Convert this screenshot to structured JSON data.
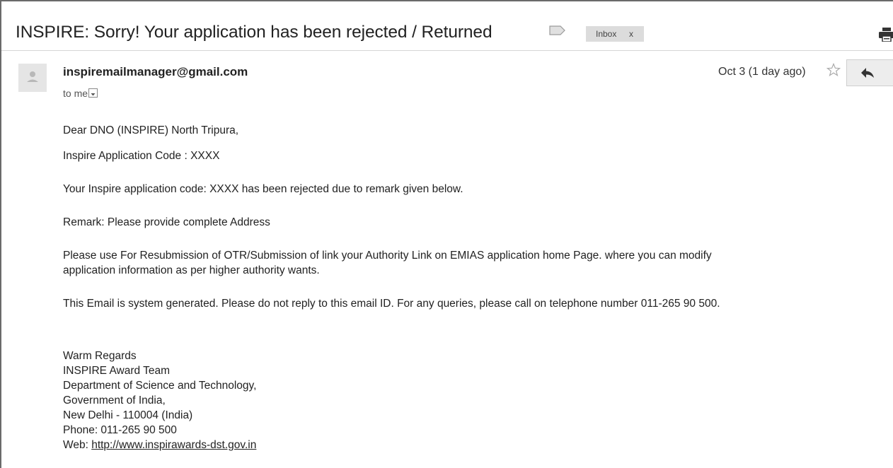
{
  "subject": "INSPIRE: Sorry! Your application has been rejected / Returned",
  "labels": {
    "inbox_label": "Inbox",
    "remove_label": "x"
  },
  "sender": {
    "email": "inspiremailmanager@gmail.com",
    "recipient": "to me",
    "date": "Oct 3 (1 day ago)"
  },
  "icons": {
    "label": "label-tag-icon",
    "print": "print-icon",
    "avatar": "person-icon",
    "star": "star-outline-icon",
    "reply": "reply-arrow-icon",
    "caret": "chevron-down-icon"
  },
  "message": {
    "greeting": "Dear DNO (INSPIRE) North Tripura,",
    "code_line": "Inspire Application Code : XXXX",
    "rejection_line": "Your Inspire application code: XXXX has been rejected due to remark given below.",
    "remark_line": "Remark: Please provide complete Address",
    "instruction_line1": "Please use For Resubmission of OTR/Submission of link your Authority Link on EMIAS application home Page. where you can modify",
    "instruction_line2": "application information as per higher authority wants.",
    "system_note": "This Email is system generated. Please do not reply to this email ID. For any queries, please call on telephone number 011-265 90 500.",
    "signature": {
      "closing": "Warm Regards",
      "team": "INSPIRE Award Team",
      "department": "Department of Science and Technology,",
      "government": "Government of India,",
      "address": "New Delhi - 110004 (India)",
      "phone": "Phone: 011-265 90 500",
      "web_prefix": "Web: ",
      "web_url": "http://www.inspirawards-dst.gov.in"
    }
  }
}
